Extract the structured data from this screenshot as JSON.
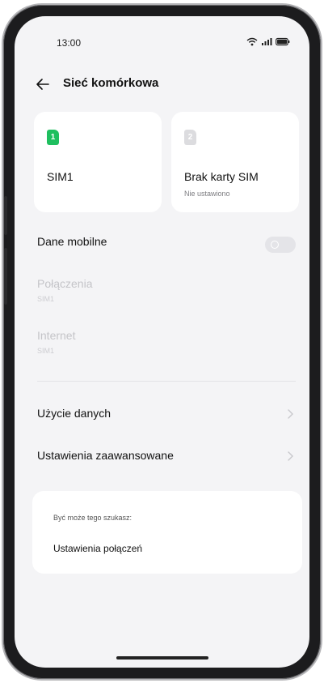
{
  "status_bar": {
    "time": "13:00",
    "icons": [
      "wifi-icon",
      "signal-icon",
      "battery-icon"
    ]
  },
  "header": {
    "back_icon": "arrow-left-icon",
    "title": "Sieć komórkowa"
  },
  "sim_cards": [
    {
      "badge": "1",
      "name": "SIM1",
      "subtitle": "",
      "badge_color": "#1fbf5f"
    },
    {
      "badge": "2",
      "name": "Brak karty SIM",
      "subtitle": "Nie ustawiono",
      "badge_color": "#dcdcdf"
    }
  ],
  "mobile_data": {
    "label": "Dane mobilne",
    "enabled": false
  },
  "calls": {
    "label": "Połączenia",
    "value": "SIM1"
  },
  "internet": {
    "label": "Internet",
    "value": "SIM1"
  },
  "menu": {
    "data_usage": "Użycie danych",
    "advanced": "Ustawienia zaawansowane"
  },
  "suggestions": {
    "heading": "Być może tego szukasz:",
    "item": "Ustawienia połączeń"
  },
  "colors": {
    "accent": "#1fbf5f",
    "background": "#f4f4f6",
    "card": "#ffffff"
  }
}
